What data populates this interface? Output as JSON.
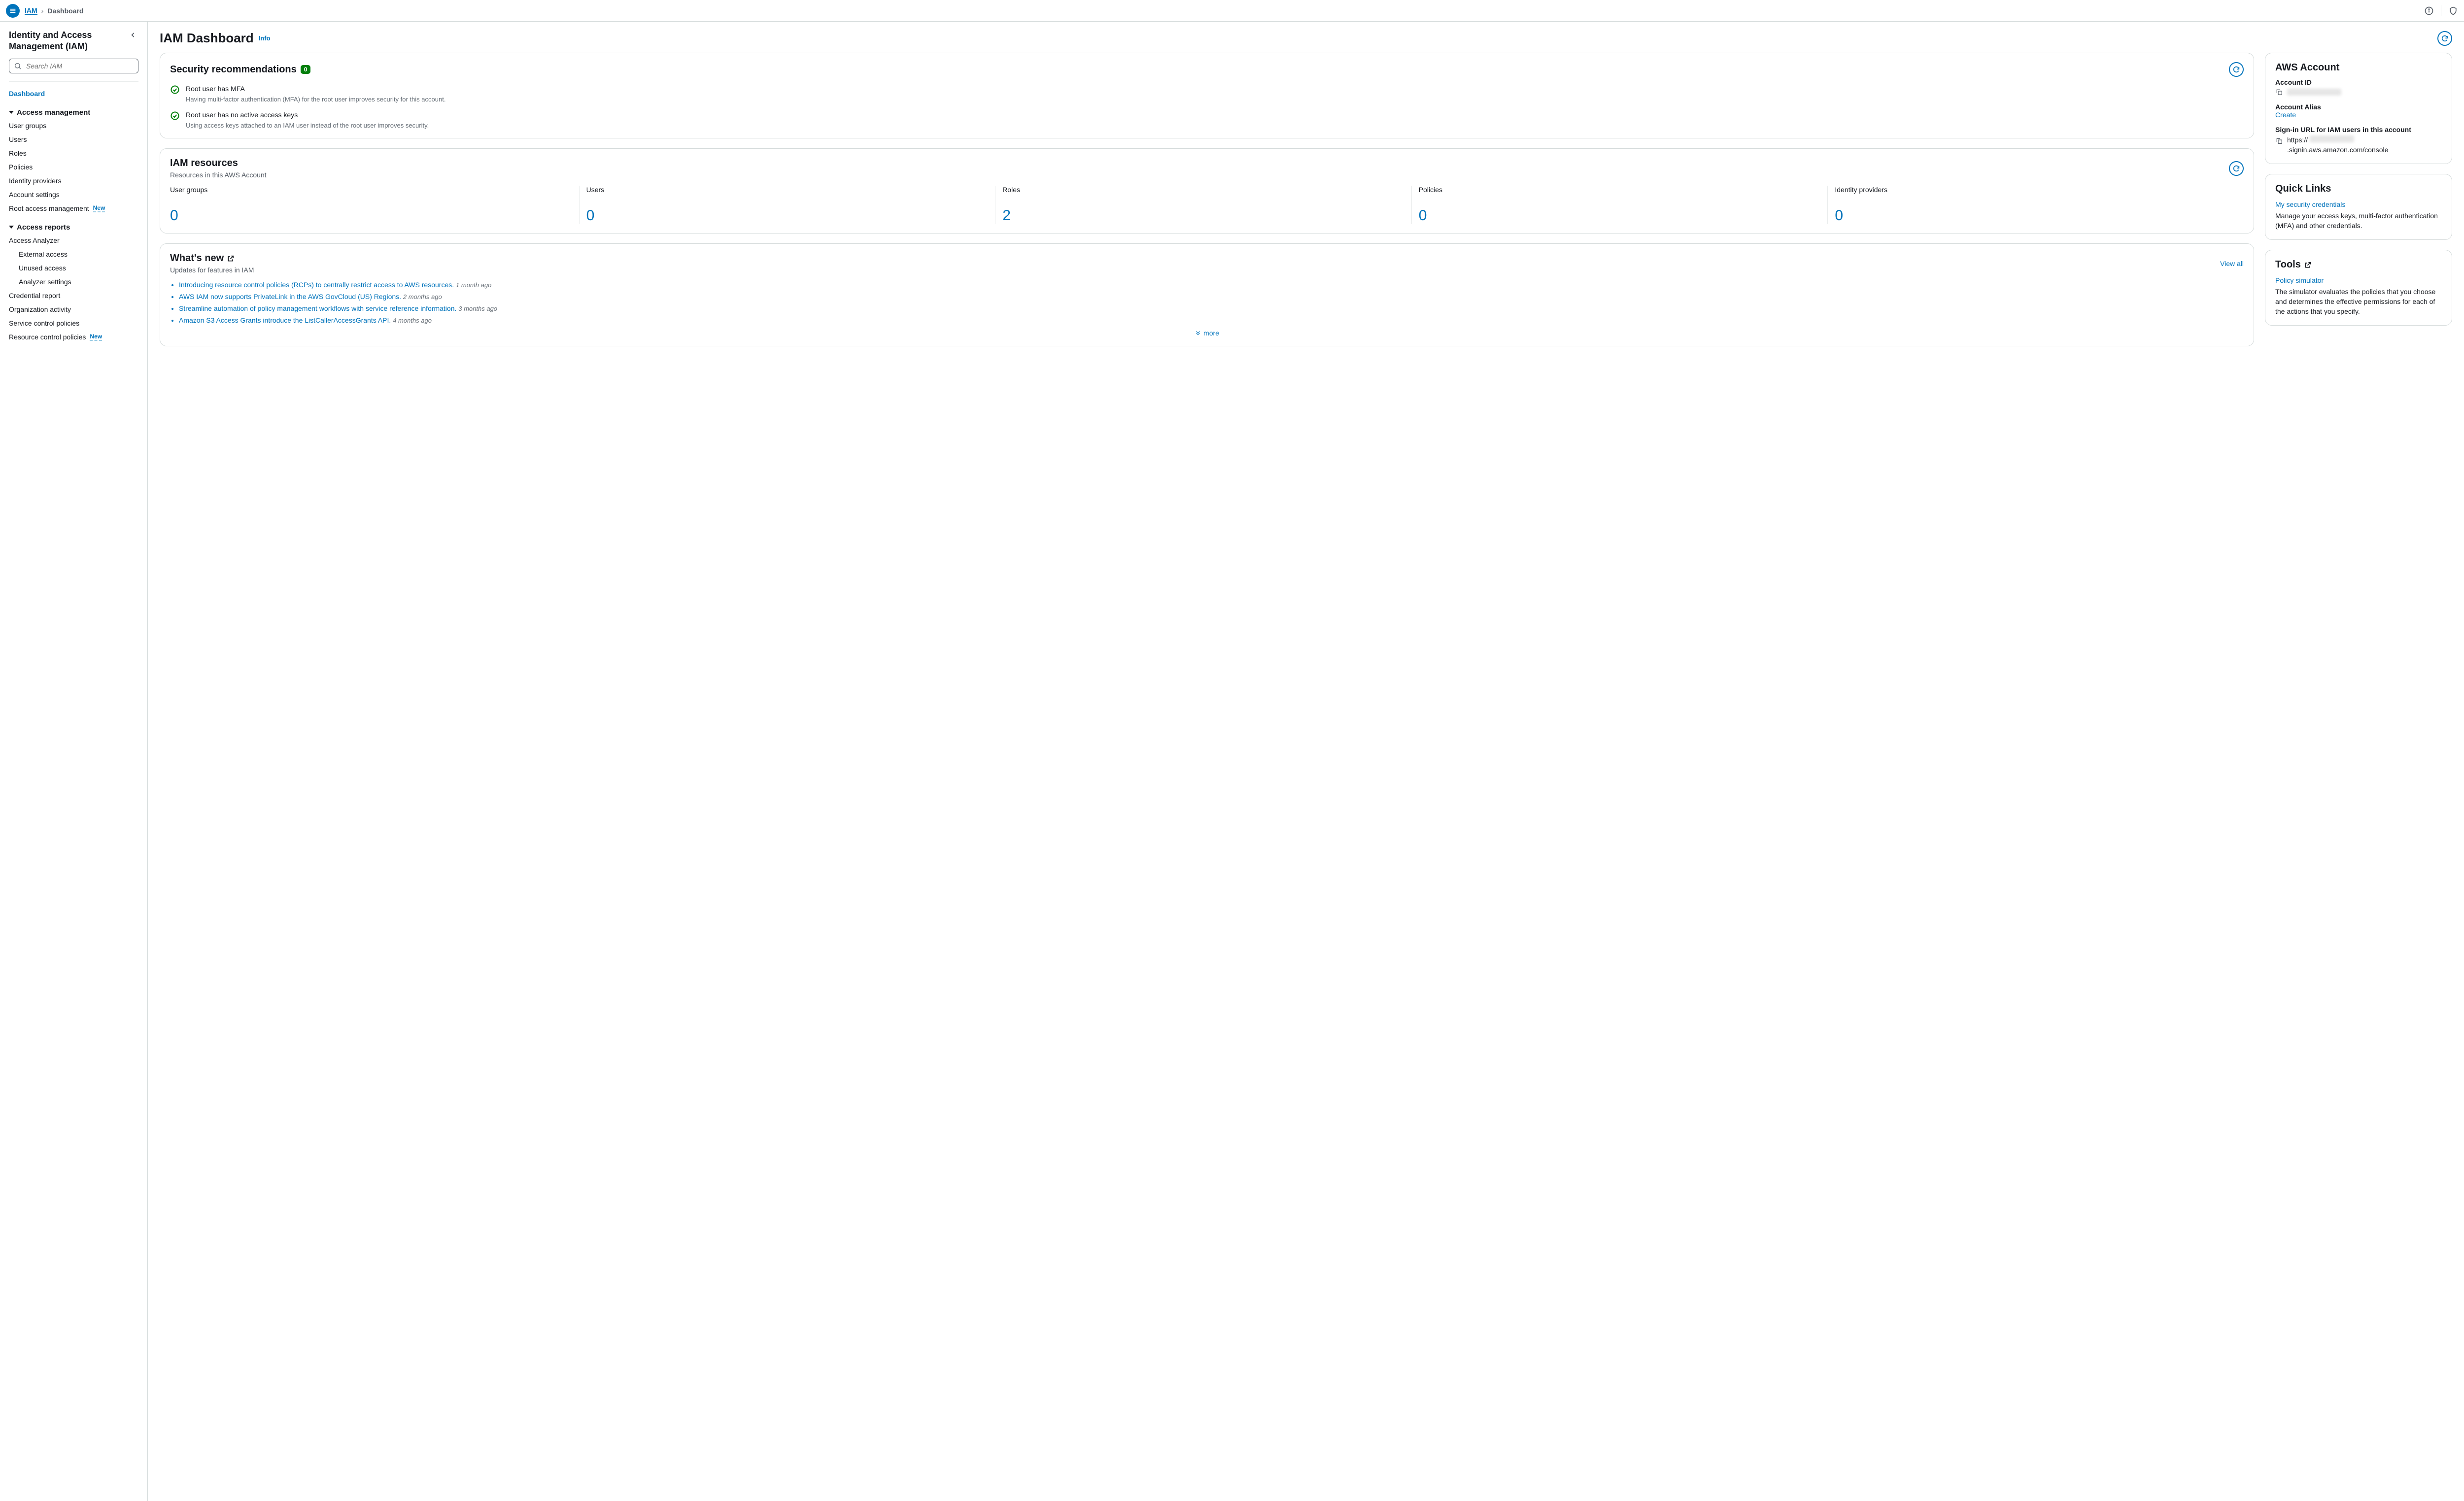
{
  "breadcrumb": {
    "root": "IAM",
    "current": "Dashboard"
  },
  "sidebar": {
    "title": "Identity and Access Management (IAM)",
    "search_placeholder": "Search IAM",
    "dashboard": "Dashboard",
    "section_access_mgmt": "Access management",
    "items_am": [
      "User groups",
      "Users",
      "Roles",
      "Policies",
      "Identity providers",
      "Account settings",
      "Root access management"
    ],
    "new_badge": "New",
    "section_access_reports": "Access reports",
    "items_ar": [
      "Access Analyzer"
    ],
    "items_ar_sub": [
      "External access",
      "Unused access",
      "Analyzer settings"
    ],
    "items_ar_rest": [
      "Credential report",
      "Organization activity",
      "Service control policies",
      "Resource control policies"
    ]
  },
  "page": {
    "title": "IAM Dashboard",
    "info": "Info"
  },
  "security": {
    "title": "Security recommendations",
    "count": "0",
    "r1_title": "Root user has MFA",
    "r1_desc": "Having multi-factor authentication (MFA) for the root user improves security for this account.",
    "r2_title": "Root user has no active access keys",
    "r2_desc": "Using access keys attached to an IAM user instead of the root user improves security."
  },
  "resources": {
    "title": "IAM resources",
    "subtitle": "Resources in this AWS Account",
    "cells": [
      {
        "label": "User groups",
        "value": "0"
      },
      {
        "label": "Users",
        "value": "0"
      },
      {
        "label": "Roles",
        "value": "2"
      },
      {
        "label": "Policies",
        "value": "0"
      },
      {
        "label": "Identity providers",
        "value": "0"
      }
    ]
  },
  "whatsnew": {
    "title": "What's new",
    "subtitle": "Updates for features in IAM",
    "view_all": "View all",
    "more": "more",
    "items": [
      {
        "text": "Introducing resource control policies (RCPs) to centrally restrict access to AWS resources.",
        "ago": "1 month ago"
      },
      {
        "text": "AWS IAM now supports PrivateLink in the AWS GovCloud (US) Regions.",
        "ago": "2 months ago"
      },
      {
        "text": "Streamline automation of policy management workflows with service reference information.",
        "ago": "3 months ago"
      },
      {
        "text": "Amazon S3 Access Grants introduce the ListCallerAccessGrants API.",
        "ago": "4 months ago"
      }
    ]
  },
  "account": {
    "title": "AWS Account",
    "id_label": "Account ID",
    "alias_label": "Account Alias",
    "create": "Create",
    "signin_label": "Sign-in URL for IAM users in this account",
    "signin_prefix": "https://",
    "signin_suffix": ".signin.aws.amazon.com/console"
  },
  "quicklinks": {
    "title": "Quick Links",
    "link": "My security credentials",
    "desc": "Manage your access keys, multi-factor authentication (MFA) and other credentials."
  },
  "tools": {
    "title": "Tools",
    "link": "Policy simulator",
    "desc": "The simulator evaluates the policies that you choose and determines the effective permissions for each of the actions that you specify."
  }
}
